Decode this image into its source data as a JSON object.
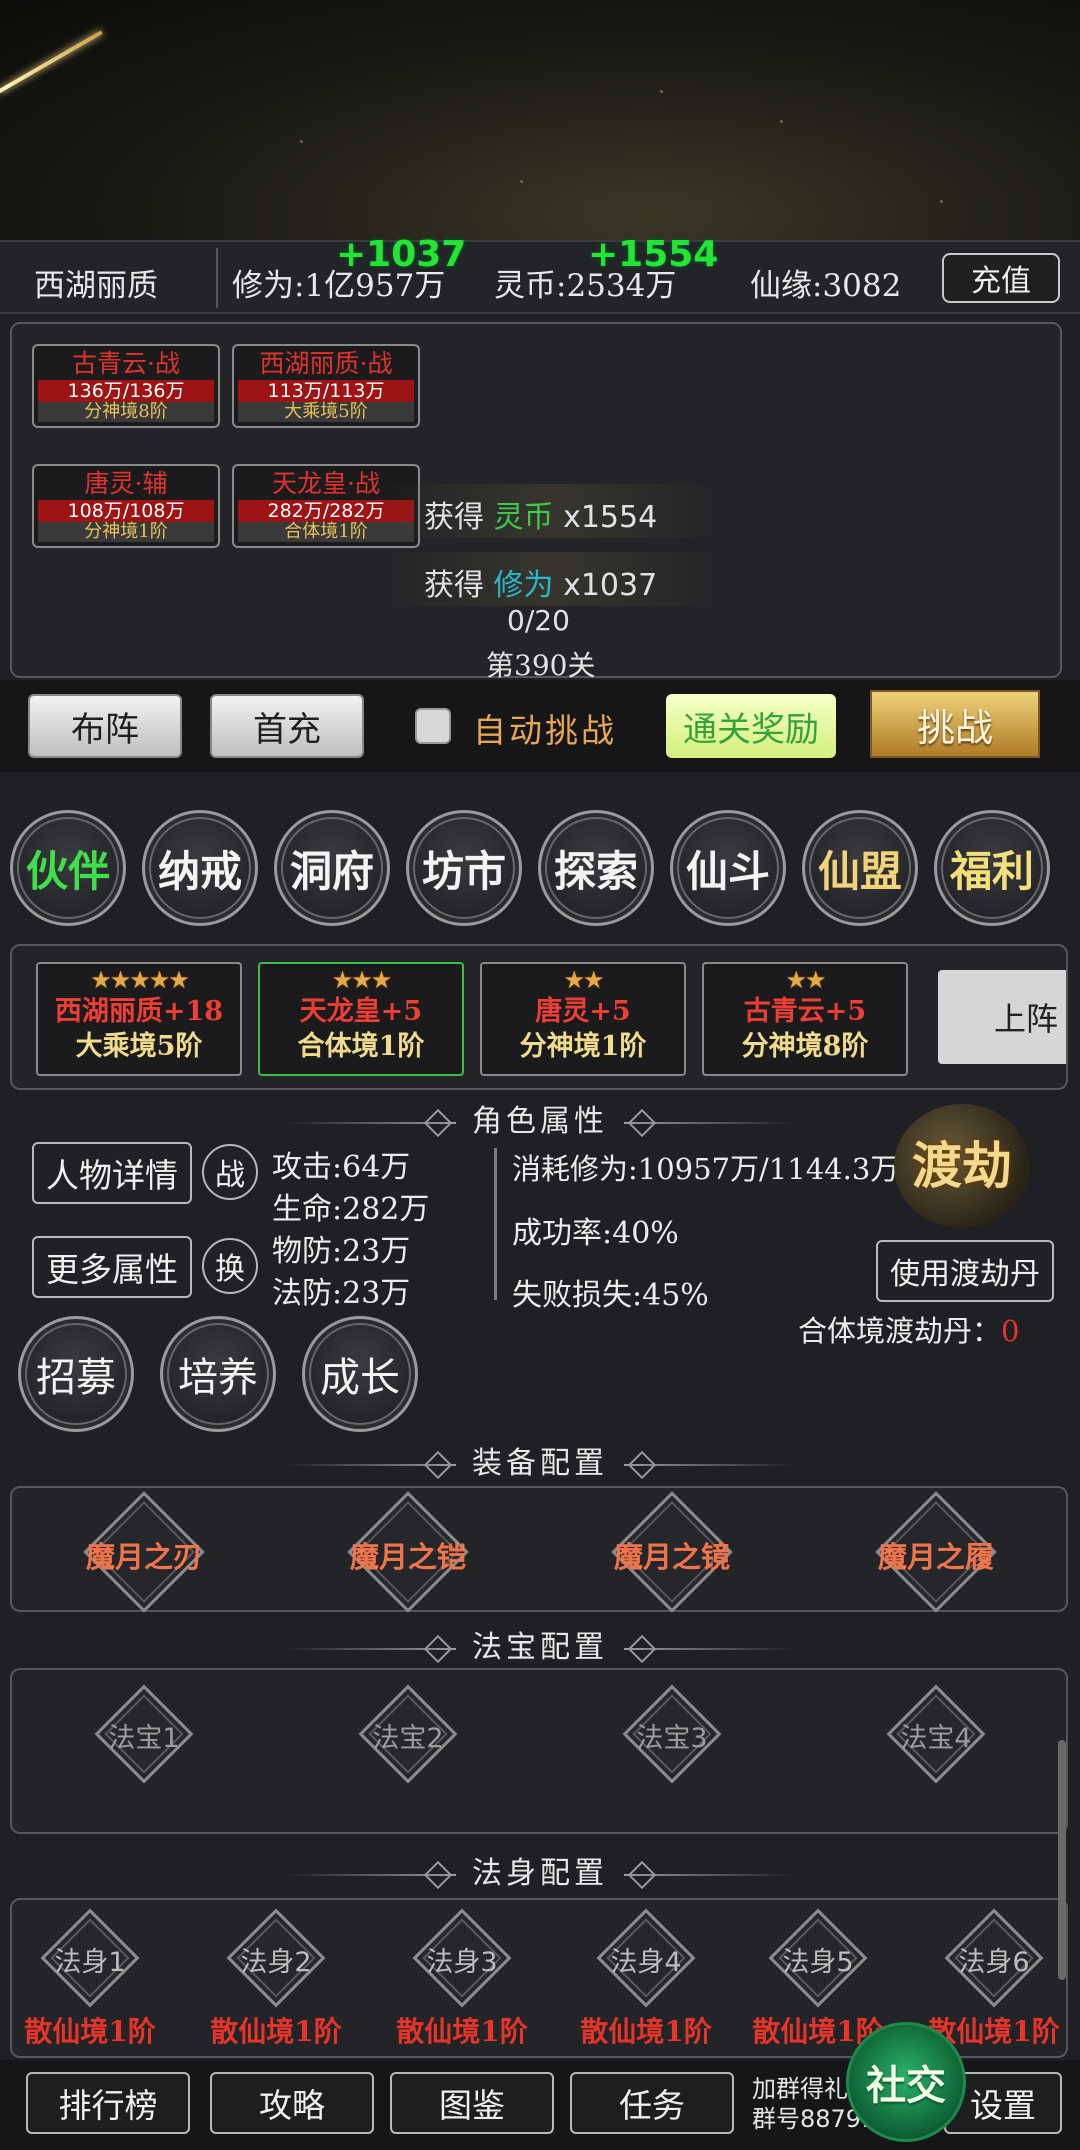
{
  "topbar": {
    "player_name": "西湖丽质",
    "cultivation": "修为:1亿957万",
    "cultivation_gain": "+1037",
    "coins": "灵币:2534万",
    "coins_gain": "+1554",
    "fate": "仙缘:3082",
    "recharge_label": "充值"
  },
  "battle": {
    "cards": [
      {
        "name": "古青云·战",
        "hp": "136万/136万",
        "level": "分神境8阶"
      },
      {
        "name": "西湖丽质·战",
        "hp": "113万/113万",
        "level": "大乘境5阶"
      },
      {
        "name": "唐灵·辅",
        "hp": "108万/108万",
        "level": "分神境1阶"
      },
      {
        "name": "天龙皇·战",
        "hp": "282万/282万",
        "level": "合体境1阶"
      }
    ],
    "gain1": {
      "prefix": "获得",
      "key": "灵币",
      "amount": "x1554"
    },
    "gain2": {
      "prefix": "获得",
      "key": "修为",
      "amount": "x1037"
    },
    "progress": "0/20",
    "stage": "第390关"
  },
  "actions": {
    "formation_label": "布阵",
    "first_charge_label": "首充",
    "auto_label": "自动挑战",
    "reward_label": "通关奖励",
    "challenge_label": "挑战"
  },
  "menu": [
    {
      "label": "伙伴",
      "color": "#3fe04a"
    },
    {
      "label": "纳戒",
      "color": "#f4f4f4"
    },
    {
      "label": "洞府",
      "color": "#f4f4f4"
    },
    {
      "label": "坊市",
      "color": "#f4f4f4"
    },
    {
      "label": "探索",
      "color": "#f4f4f4"
    },
    {
      "label": "仙斗",
      "color": "#f4f4f4"
    },
    {
      "label": "仙盟",
      "color": "#f3d37a"
    },
    {
      "label": "福利",
      "color": "#f3e07a"
    }
  ],
  "partners": [
    {
      "stars": "★★★★★",
      "name": "西湖丽质+18",
      "level": "大乘境5阶"
    },
    {
      "stars": "★★★",
      "name": "天龙皇+5",
      "level": "合体境1阶"
    },
    {
      "stars": "★★",
      "name": "唐灵+5",
      "level": "分神境1阶"
    },
    {
      "stars": "★★",
      "name": "古青云+5",
      "level": "分神境8阶"
    }
  ],
  "partners_next": "上阵",
  "attributes": {
    "title": "角色属性",
    "detail_btn": "人物详情",
    "more_btn": "更多属性",
    "battle_badge": "战",
    "swap_badge": "换",
    "attack": "攻击:64万",
    "life": "生命:282万",
    "pdef": "物防:23万",
    "mdef": "法防:23万",
    "consume": "消耗修为:10957万/1144.3万",
    "success": "成功率:40%",
    "fail": "失败损失:45%",
    "dujie_logo": "渡劫",
    "use_pill_btn": "使用渡劫丹",
    "pill_label": "合体境渡劫丹：",
    "pill_count": "0"
  },
  "sub_actions": [
    "招募",
    "培养",
    "成长"
  ],
  "equipment": {
    "title": "装备配置",
    "items": [
      "魔月之刃",
      "魔月之铠",
      "魔月之镜",
      "魔月之履"
    ]
  },
  "treasures": {
    "title": "法宝配置",
    "items": [
      "法宝1",
      "法宝2",
      "法宝3",
      "法宝4"
    ]
  },
  "avatars": {
    "title": "法身配置",
    "items": [
      {
        "name": "法身1",
        "level": "散仙境1阶"
      },
      {
        "name": "法身2",
        "level": "散仙境1阶"
      },
      {
        "name": "法身3",
        "level": "散仙境1阶"
      },
      {
        "name": "法身4",
        "level": "散仙境1阶"
      },
      {
        "name": "法身5",
        "level": "散仙境1阶"
      },
      {
        "name": "法身6",
        "level": "散仙境1阶"
      }
    ]
  },
  "bottom": {
    "rank": "排行榜",
    "guide": "攻略",
    "codex": "图鉴",
    "task": "任务",
    "group_line1": "加群得礼",
    "group_line2": "群号887919857",
    "social": "社交",
    "settings": "设置"
  }
}
